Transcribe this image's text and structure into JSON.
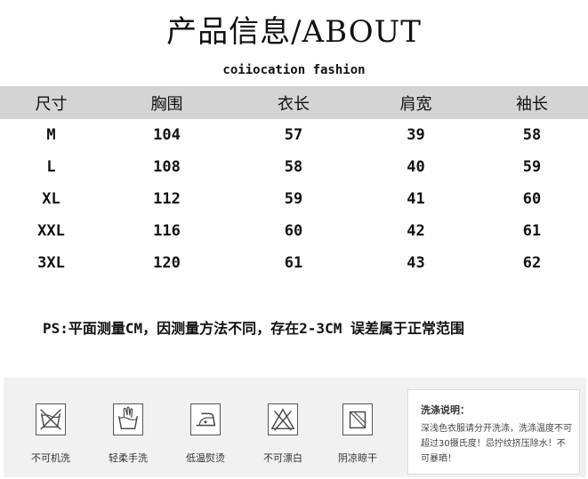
{
  "title": "产品信息/ABOUT",
  "brand": "coiiocation fashion",
  "table": {
    "headers": [
      "尺寸",
      "胸围",
      "衣长",
      "肩宽",
      "袖长"
    ],
    "rows": [
      [
        "M",
        "104",
        "57",
        "39",
        "58"
      ],
      [
        "L",
        "108",
        "58",
        "40",
        "59"
      ],
      [
        "XL",
        "112",
        "59",
        "41",
        "60"
      ],
      [
        "XXL",
        "116",
        "60",
        "42",
        "61"
      ],
      [
        "3XL",
        "120",
        "61",
        "43",
        "62"
      ]
    ]
  },
  "note": "PS:平面测量CM，因测量方法不同，存在2-3CM 误差属于正常范围",
  "care": {
    "icons": [
      {
        "icon": "no-machine-wash-icon",
        "label": "不可机洗"
      },
      {
        "icon": "gentle-hand-wash-icon",
        "label": "轻柔手洗"
      },
      {
        "icon": "low-temperature-iron-icon",
        "label": "低温熨烫"
      },
      {
        "icon": "do-not-bleach-icon",
        "label": "不可漂白"
      },
      {
        "icon": "shade-dry-icon",
        "label": "阴凉晾干"
      }
    ],
    "info_title": "洗涤说明：",
    "info_body": "深浅色衣服请分开洗涤，洗涤温度不可超过30摄氏度！忌拧纹挤压除水！不可暴晒！"
  }
}
